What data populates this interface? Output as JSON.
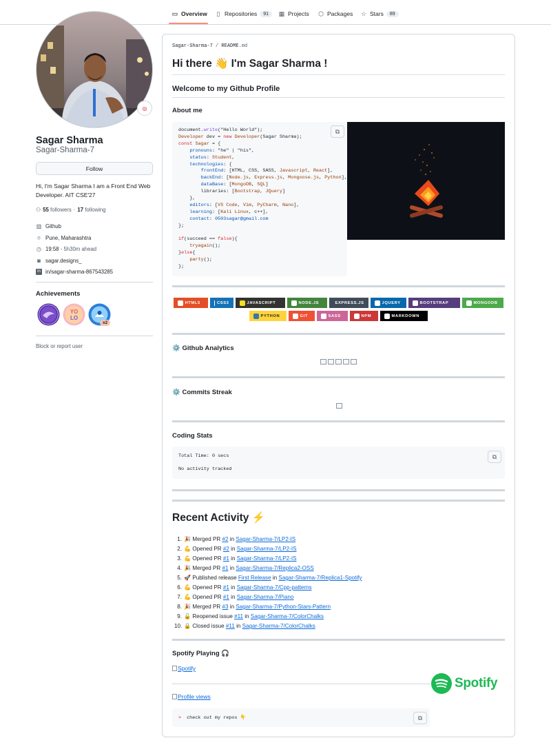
{
  "nav": {
    "tabs": [
      {
        "label": "Overview",
        "icon": "book-icon",
        "active": true
      },
      {
        "label": "Repositories",
        "icon": "repo-icon",
        "count": "91"
      },
      {
        "label": "Projects",
        "icon": "table-icon"
      },
      {
        "label": "Packages",
        "icon": "package-icon"
      },
      {
        "label": "Stars",
        "icon": "star-icon",
        "count": "89"
      }
    ]
  },
  "profile": {
    "name": "Sagar Sharma",
    "login": "Sagar-Sharma-7",
    "follow_label": "Follow",
    "bio": "Hi, I'm Sagar Sharma I am a Front End Web Developer. AIT CSE'27",
    "followers_count": "55",
    "followers_label": "followers",
    "dot": "·",
    "following_count": "17",
    "following_label": "following",
    "company": "Github",
    "location": "Pune, Maharashtra",
    "time": "19:58",
    "time_note": "- 5h30m ahead",
    "social_1": "sagar.designs_",
    "social_2": "in/sagar-sharma-867543285",
    "achievements_title": "Achievements",
    "achievement_multiplier": "x2",
    "block_label": "Block or report user"
  },
  "readme": {
    "owner": "Sagar-Sharma-7",
    "sep": "/",
    "file": "README",
    "ext": ".md",
    "title": "Hi there 👋 I'm Sagar Sharma !",
    "welcome": "Welcome to my Github Profile",
    "about": "About me",
    "analytics": "⚙️ Github Analytics",
    "streak": "⚙️ Commits Streak",
    "coding": "Coding Stats",
    "total_time": "Total Time: 0 secs",
    "no_activity": "No activity tracked",
    "recent": "Recent Activity ⚡",
    "spotify_heading": "Spotify Playing 🎧",
    "spotify_link": "Spotify",
    "spotify_brand": "Spotify",
    "views_link": "Profile views",
    "snippet_prompt": ">",
    "snippet_text": "check out my repos 👇"
  },
  "code_lines": [
    [
      [
        "",
        "document."
      ],
      [
        "f",
        "write"
      ],
      [
        "",
        "(\"Hello World\");"
      ]
    ],
    [
      [
        "v",
        "Developer"
      ],
      [
        "",
        " dev = "
      ],
      [
        "k",
        "new"
      ],
      [
        "",
        " "
      ],
      [
        "v",
        "Developer"
      ],
      [
        "",
        "(Sagar Sharma);"
      ]
    ],
    [
      [
        "k",
        "const"
      ],
      [
        "",
        " "
      ],
      [
        "v",
        "Sagar"
      ],
      [
        "",
        " = {"
      ]
    ],
    [
      [
        "",
        "    "
      ],
      [
        "p",
        "pronouns"
      ],
      [
        "",
        ": \"he\" | \"his\","
      ]
    ],
    [
      [
        "",
        "    "
      ],
      [
        "p",
        "status"
      ],
      [
        "",
        ": "
      ],
      [
        "v",
        "Student"
      ],
      [
        "",
        ","
      ]
    ],
    [
      [
        "",
        "    "
      ],
      [
        "p",
        "technologies"
      ],
      [
        "",
        ": {"
      ]
    ],
    [
      [
        "",
        "        "
      ],
      [
        "p",
        "frontEnd"
      ],
      [
        "",
        ": [HTML, CSS, SASS, "
      ],
      [
        "v",
        "Javascript"
      ],
      [
        "",
        ", "
      ],
      [
        "v",
        "React"
      ],
      [
        "",
        "],"
      ]
    ],
    [
      [
        "",
        "        "
      ],
      [
        "p",
        "backEnd"
      ],
      [
        "",
        ": ["
      ],
      [
        "v",
        "Node.js"
      ],
      [
        "",
        ", "
      ],
      [
        "v",
        "Express.js"
      ],
      [
        "",
        ", "
      ],
      [
        "v",
        "Mongoose.js"
      ],
      [
        "",
        ", "
      ],
      [
        "v",
        "Python"
      ],
      [
        "",
        "],"
      ]
    ],
    [
      [
        "",
        "        "
      ],
      [
        "p",
        "dataBase"
      ],
      [
        "",
        ": ["
      ],
      [
        "v",
        "MongoDB"
      ],
      [
        "",
        ", "
      ],
      [
        "v",
        "SQL"
      ],
      [
        "",
        "]"
      ]
    ],
    [
      [
        "",
        "        libraries: ["
      ],
      [
        "v",
        "Bootstrap"
      ],
      [
        "",
        ", "
      ],
      [
        "v",
        "JQuery"
      ],
      [
        "",
        "]"
      ]
    ],
    [
      [
        "",
        "    },"
      ]
    ],
    [
      [
        "",
        "    "
      ],
      [
        "p",
        "editors"
      ],
      [
        "",
        ": ["
      ],
      [
        "v",
        "VS Code"
      ],
      [
        "",
        ", "
      ],
      [
        "v",
        "Vim"
      ],
      [
        "",
        ", "
      ],
      [
        "v",
        "PyCharm"
      ],
      [
        "",
        ", "
      ],
      [
        "v",
        "Nano"
      ],
      [
        "",
        "],"
      ]
    ],
    [
      [
        "",
        "    "
      ],
      [
        "p",
        "learning"
      ],
      [
        "",
        ": ["
      ],
      [
        "v",
        "Kali Linux"
      ],
      [
        "",
        ", c++],"
      ]
    ],
    [
      [
        "",
        "    "
      ],
      [
        "p",
        "contact"
      ],
      [
        "",
        ": "
      ],
      [
        "p",
        "0503sagar@gmail.com"
      ]
    ],
    [
      [
        "",
        "};"
      ]
    ],
    [
      [
        "",
        ""
      ]
    ],
    [
      [
        "k",
        "if"
      ],
      [
        "",
        "(succeed == "
      ],
      [
        "k",
        "false"
      ],
      [
        "",
        "){"
      ]
    ],
    [
      [
        "",
        "    "
      ],
      [
        "v",
        "tryagain"
      ],
      [
        "",
        "();"
      ]
    ],
    [
      [
        "",
        "}"
      ],
      [
        "k",
        "else"
      ],
      [
        "",
        "{"
      ]
    ],
    [
      [
        "",
        "    "
      ],
      [
        "v",
        "party"
      ],
      [
        "",
        "();"
      ]
    ],
    [
      [
        "",
        "};"
      ]
    ]
  ],
  "tech_badges": [
    {
      "label": "HTML5",
      "color": "#e34f26",
      "icon_color": "#ffffff"
    },
    {
      "label": "CSS3",
      "color": "#1572b6",
      "icon_color": "#ffffff"
    },
    {
      "label": "JAVASCRIPT",
      "color": "#323330",
      "icon_color": "#f7df1e"
    },
    {
      "label": "NODE.JS",
      "color": "#43853d",
      "icon_color": "#ffffff"
    },
    {
      "label": "EXPRESS.JS",
      "color": "#404d59",
      "icon_color": "#61dafb"
    },
    {
      "label": "JQUERY",
      "color": "#0769ad",
      "icon_color": "#ffffff"
    },
    {
      "label": "BOOTSTRAP",
      "color": "#563d7c",
      "icon_color": "#ffffff"
    },
    {
      "label": "MONGODB",
      "color": "#4ea94b",
      "icon_color": "#ffffff"
    },
    {
      "label": "PYTHON",
      "color": "#ffd43b",
      "icon_color": "#3776ab"
    },
    {
      "label": "GIT",
      "color": "#f05033",
      "icon_color": "#ffffff"
    },
    {
      "label": "SASS",
      "color": "#cc6699",
      "icon_color": "#ffffff"
    },
    {
      "label": "NPM",
      "color": "#cb3837",
      "icon_color": "#ffffff"
    },
    {
      "label": "MARKDOWN",
      "color": "#000000",
      "icon_color": "#ffffff"
    }
  ],
  "activity": [
    {
      "num": "1.",
      "emoji": "🎉",
      "action": "Merged PR",
      "pr": "#2",
      "in": "in",
      "repo": "Sagar-Sharma-7/LP2-IS"
    },
    {
      "num": "2.",
      "emoji": "💪",
      "action": "Opened PR",
      "pr": "#2",
      "in": "in",
      "repo": "Sagar-Sharma-7/LP2-IS"
    },
    {
      "num": "3.",
      "emoji": "💪",
      "action": "Opened PR",
      "pr": "#1",
      "in": "in",
      "repo": "Sagar-Sharma-7/LP2-IS"
    },
    {
      "num": "4.",
      "emoji": "🎉",
      "action": "Merged PR",
      "pr": "#1",
      "in": "in",
      "repo": "Sagar-Sharma-7/Replica2-OSS"
    },
    {
      "num": "5.",
      "emoji": "🚀",
      "action": "Published release",
      "pr": "First Release",
      "in": "in",
      "repo": "Sagar-Sharma-7/Replica1-Spotify"
    },
    {
      "num": "6.",
      "emoji": "💪",
      "action": "Opened PR",
      "pr": "#1",
      "in": "in",
      "repo": "Sagar-Sharma-7/Cpp-patterns"
    },
    {
      "num": "7.",
      "emoji": "💪",
      "action": "Opened PR",
      "pr": "#1",
      "in": "in",
      "repo": "Sagar-Sharma-7/Piano"
    },
    {
      "num": "8.",
      "emoji": "🎉",
      "action": "Merged PR",
      "pr": "#3",
      "in": "in",
      "repo": "Sagar-Sharma-7/Python-Stars-Pattern"
    },
    {
      "num": "9.",
      "emoji": "🔓",
      "action": "Reopened issue",
      "pr": "#11",
      "in": "in",
      "repo": "Sagar-Sharma-7/ColorChalks"
    },
    {
      "num": "10.",
      "emoji": "🔒",
      "action": "Closed issue",
      "pr": "#11",
      "in": "in",
      "repo": "Sagar-Sharma-7/ColorChalks"
    }
  ],
  "colors": {
    "accent_underline": "#fd8c73",
    "link": "#0969da",
    "spotify_green": "#1db954"
  }
}
